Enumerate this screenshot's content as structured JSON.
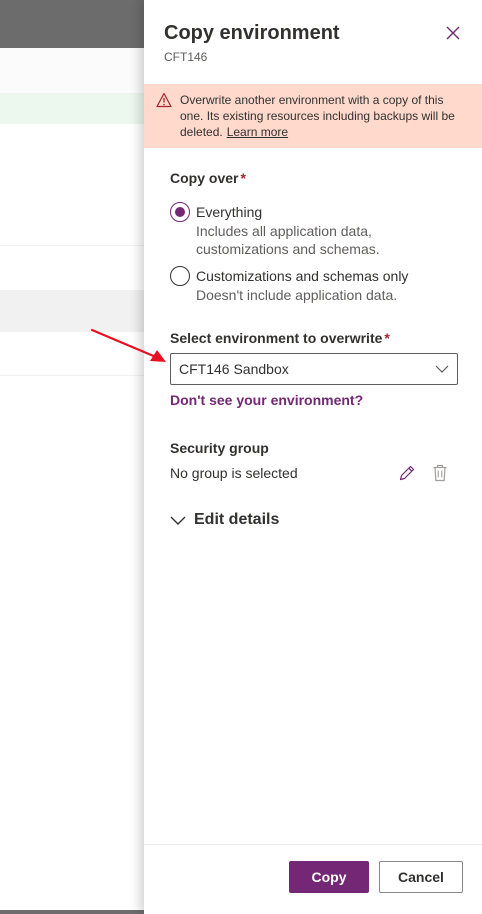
{
  "panel": {
    "title": "Copy environment",
    "subtitle": "CFT146",
    "close_icon": "close-icon"
  },
  "warning": {
    "icon": "warning-icon",
    "text": "Overwrite another environment with a copy of this one. Its existing resources including backups will be deleted.",
    "link": "Learn more"
  },
  "copy_over": {
    "label": "Copy over",
    "required_mark": "*",
    "options": [
      {
        "title": "Everything",
        "description": "Includes all application data, customizations and schemas.",
        "selected": true
      },
      {
        "title": "Customizations and schemas only",
        "description": "Doesn't include application data.",
        "selected": false
      }
    ]
  },
  "target": {
    "label": "Select environment to overwrite",
    "required_mark": "*",
    "selected_value": "CFT146 Sandbox",
    "help_link": "Don't see your environment?"
  },
  "security_group": {
    "label": "Security group",
    "value": "No group is selected",
    "edit_icon": "pencil-icon",
    "delete_icon": "trash-icon"
  },
  "edit_details": {
    "label": "Edit details",
    "icon": "chevron-down-icon"
  },
  "footer": {
    "primary_label": "Copy",
    "secondary_label": "Cancel"
  },
  "colors": {
    "accent": "#742774",
    "warning_bg": "#fed9cc",
    "annotation_arrow": "#e81123"
  }
}
